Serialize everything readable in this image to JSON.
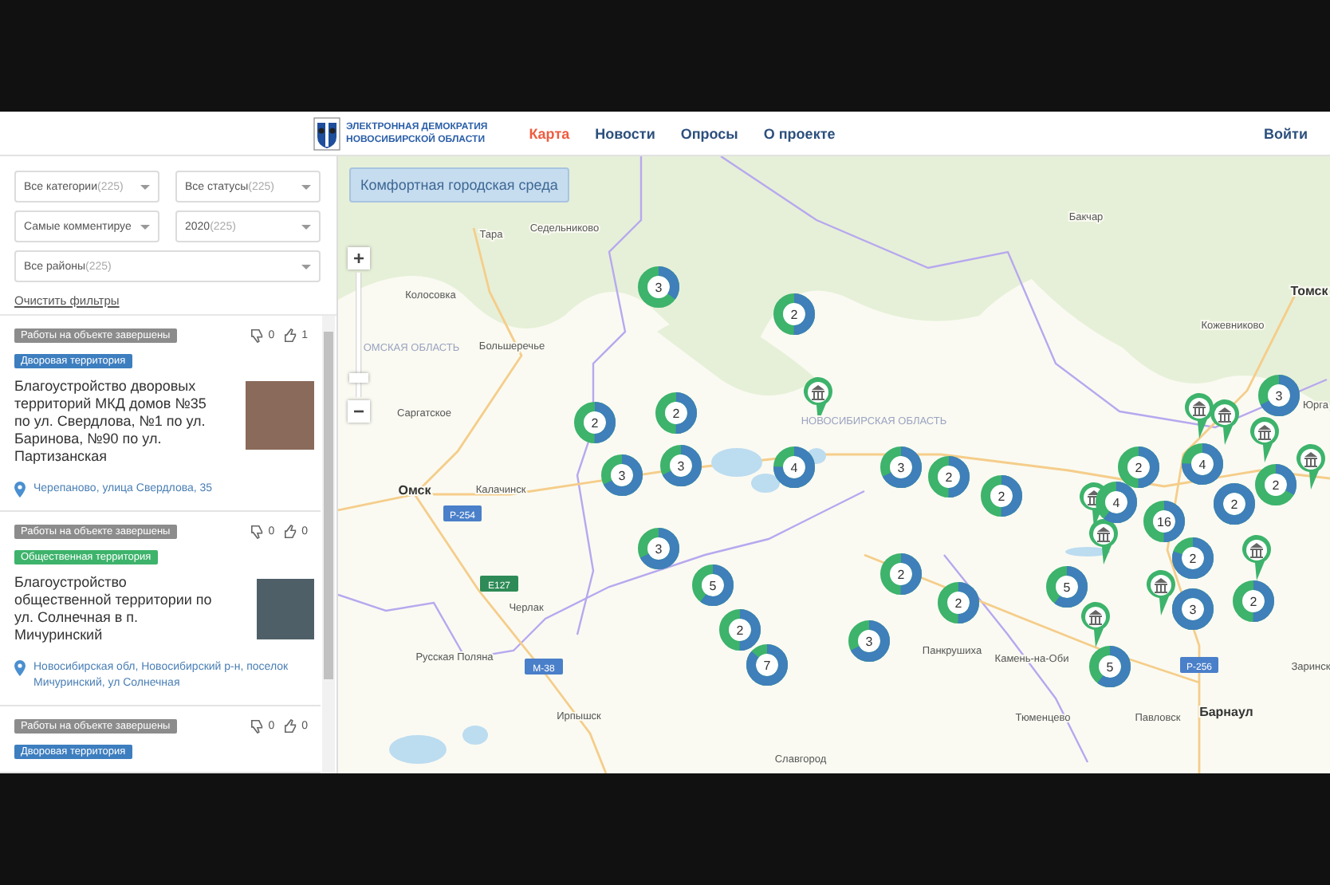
{
  "header": {
    "logo_lines": [
      "ЭЛЕКТРОННАЯ ДЕМОКРАТИЯ",
      "НОВОСИБИРСКОЙ ОБЛАСТИ"
    ],
    "nav": [
      {
        "label": "Карта",
        "selected": true
      },
      {
        "label": "Новости",
        "selected": false
      },
      {
        "label": "Опросы",
        "selected": false
      },
      {
        "label": "О проекте",
        "selected": false
      }
    ],
    "login": "Войти"
  },
  "filters": [
    {
      "label": "Все категории",
      "count": "(225)"
    },
    {
      "label": "Все статусы",
      "count": "(225)"
    },
    {
      "label": "Самые комментируе"
    },
    {
      "label": "2020",
      "count": "(225)"
    },
    {
      "label": "Все районы",
      "count": "(225)"
    }
  ],
  "clear_filters": "Очистить фильтры",
  "projects": [
    {
      "status": "Работы на объекте завершены",
      "dislikes": "0",
      "likes": "1",
      "category": {
        "label": "Дворовая территория",
        "kind": "yard"
      },
      "title": "Благоустройство дворовых территорий МКД домов №35 по ул. Свердлова, №1 по ул. Баринова, №90 по ул. Партизанская",
      "address": "Черепаново, улица Свердлова, 35"
    },
    {
      "status": "Работы на объекте завершены",
      "dislikes": "0",
      "likes": "0",
      "category": {
        "label": "Общественная территория",
        "kind": "public"
      },
      "title": "Благоустройство общественной территории по ул. Солнечная в п. Мичуринский",
      "address": "Новосибирская обл, Новосибирский р-н, поселок Мичуринский, ул Солнечная"
    },
    {
      "status": "Работы на объекте завершены",
      "dislikes": "0",
      "likes": "0",
      "category": {
        "label": "Дворовая территория",
        "kind": "yard"
      }
    }
  ],
  "map": {
    "layer_button": "Комфортная городская среда",
    "zoom": {
      "zoom_in": "+",
      "zoom_out": "−",
      "level": 0.15
    },
    "places": [
      {
        "name": "Тара",
        "kind": "town"
      },
      {
        "name": "Седельниково",
        "kind": "town"
      },
      {
        "name": "Колосовка",
        "kind": "town"
      },
      {
        "name": "ОМСКАЯ ОБЛАСТЬ",
        "kind": "region"
      },
      {
        "name": "Большеречье",
        "kind": "town"
      },
      {
        "name": "Саргатское",
        "kind": "town"
      },
      {
        "name": "Омск",
        "kind": "city"
      },
      {
        "name": "Калачинск",
        "kind": "town"
      },
      {
        "name": "Черлак",
        "kind": "town"
      },
      {
        "name": "Русская Поляна",
        "kind": "town"
      },
      {
        "name": "Ирпышск",
        "kind": "town"
      },
      {
        "name": "НОВОСИБИРСКАЯ ОБЛАСТЬ",
        "kind": "region"
      },
      {
        "name": "Бакчар",
        "kind": "town"
      },
      {
        "name": "Томск",
        "kind": "city"
      },
      {
        "name": "Кожевниково",
        "kind": "town"
      },
      {
        "name": "Юрга",
        "kind": "town"
      },
      {
        "name": "Панкрушиха",
        "kind": "town"
      },
      {
        "name": "Камень-на-Оби",
        "kind": "town"
      },
      {
        "name": "Тюменцево",
        "kind": "town"
      },
      {
        "name": "Павловск",
        "kind": "town"
      },
      {
        "name": "Барнаул",
        "kind": "city"
      },
      {
        "name": "Заринск",
        "kind": "town"
      },
      {
        "name": "Славгород",
        "kind": "town"
      },
      {
        "name": "Р-254",
        "kind": "road"
      },
      {
        "name": "E127",
        "kind": "euroroad"
      },
      {
        "name": "М-38",
        "kind": "road"
      },
      {
        "name": "Р-256",
        "kind": "road"
      }
    ],
    "clusters": [
      {
        "count": "3",
        "level": 0.35
      },
      {
        "count": "2",
        "level": 0.5
      },
      {
        "count": "2",
        "level": 0.5
      },
      {
        "count": "2",
        "level": 0.5
      },
      {
        "count": "3",
        "level": 0.67
      },
      {
        "count": "3",
        "level": 0.67
      },
      {
        "count": "4",
        "level": 0.75
      },
      {
        "count": "3",
        "level": 0.67
      },
      {
        "count": "5",
        "level": 0.6
      },
      {
        "count": "2",
        "level": 0.5
      },
      {
        "count": "7",
        "level": 0.86
      },
      {
        "count": "3",
        "level": 0.67
      },
      {
        "count": "2",
        "level": 0.5
      },
      {
        "count": "2",
        "level": 0.5
      },
      {
        "count": "2",
        "level": 0.5
      },
      {
        "count": "2",
        "level": 0.5
      },
      {
        "count": "3",
        "level": 0.67
      },
      {
        "count": "5",
        "level": 0.6
      },
      {
        "count": "5",
        "level": 0.6
      },
      {
        "count": "2",
        "level": 0.5
      },
      {
        "count": "4",
        "level": 0.75
      },
      {
        "count": "2",
        "level": 1
      },
      {
        "count": "3",
        "level": 0.67
      },
      {
        "count": "2",
        "level": 0.33
      },
      {
        "count": "4",
        "level": 0.6
      },
      {
        "count": "16",
        "level": 0.5
      },
      {
        "count": "2",
        "level": 0.8
      },
      {
        "count": "3",
        "level": 1
      },
      {
        "count": "2",
        "level": 0.5
      }
    ]
  }
}
